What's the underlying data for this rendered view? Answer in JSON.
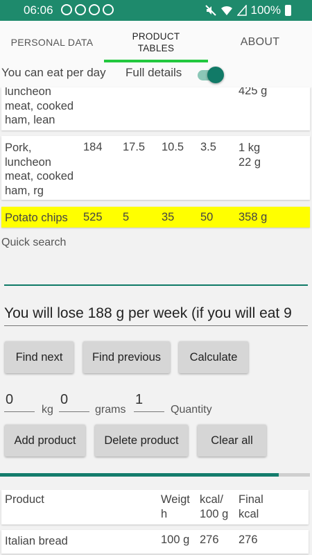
{
  "status_bar": {
    "time": "06:06",
    "battery": "100%"
  },
  "tabs": [
    {
      "label": "PERSONAL DATA"
    },
    {
      "label": "PRODUCT\nTABLES"
    },
    {
      "label": "ABOUT"
    }
  ],
  "settings": {
    "eat_per_day_label": "You can eat per day",
    "full_details_label": "Full details",
    "full_details_on": true
  },
  "food_rows": [
    {
      "name": "luncheon\nmeat, cooked\nham, lean",
      "final": "425 g",
      "partial": true
    },
    {
      "name": "Pork,\nluncheon\nmeat, cooked\nham, rg",
      "kcal": "184",
      "protein": "17.5",
      "fat": "10.5",
      "carbs": "3.5",
      "final": "1 kg\n22 g"
    },
    {
      "name": "Potato chips",
      "kcal": "525",
      "protein": "5",
      "fat": "35",
      "carbs": "50",
      "final": "358 g",
      "highlighted": true
    }
  ],
  "quick_search": {
    "label": "Quick search",
    "value": ""
  },
  "lose_message": "You will lose 188 g per week (if you will eat 9",
  "buttons": {
    "find_next": "Find next",
    "find_previous": "Find previous",
    "calculate": "Calculate",
    "add_product": "Add product",
    "delete_product": "Delete product",
    "clear_all": "Clear all"
  },
  "amount": {
    "kg_value": "0",
    "kg_unit": "kg",
    "grams_value": "0",
    "grams_unit": "grams",
    "quantity_value": "1",
    "quantity_unit": "Quantity"
  },
  "progress": {
    "fraction": 0.9
  },
  "selected_table": {
    "headers": {
      "product": "Product",
      "weight": "Weigt\nh",
      "kcal_per_100": "kcal/\n100 g",
      "final_kcal": "Final\nkcal"
    },
    "rows": [
      {
        "product": "Italian bread",
        "weight": "100 g",
        "kcal_per_100": "276",
        "final_kcal": "276"
      }
    ]
  }
}
